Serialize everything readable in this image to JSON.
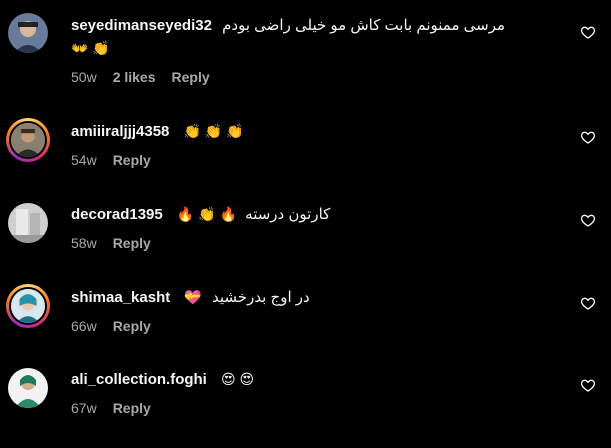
{
  "comments": [
    {
      "username": "seyedimanseyedi32",
      "text": "مرسی ممنونم بابت کاش مو خیلی راضی بودم",
      "emoji": "👐 👏",
      "time": "50w",
      "likes": "2 likes",
      "reply": "Reply"
    },
    {
      "username": "amiiiraljjj4358",
      "text": "",
      "emoji": "👏 👏 👏",
      "time": "54w",
      "likes": "",
      "reply": "Reply"
    },
    {
      "username": "decorad1395",
      "text": "کارتون درسته",
      "emoji": "🔥 👏 🔥",
      "time": "58w",
      "likes": "",
      "reply": "Reply"
    },
    {
      "username": "shimaa_kasht",
      "text": "در اوج بدرخشید",
      "emoji": "💝",
      "time": "66w",
      "likes": "",
      "reply": "Reply"
    },
    {
      "username": "ali_collection.foghi",
      "text": "",
      "emoji": "😍 😍",
      "time": "67w",
      "likes": "",
      "reply": "Reply"
    }
  ],
  "icons": {
    "like": "heart-outline-icon"
  },
  "colors": {
    "background": "#000000",
    "text": "#f5f5f5",
    "secondary": "#a8a8a8"
  }
}
